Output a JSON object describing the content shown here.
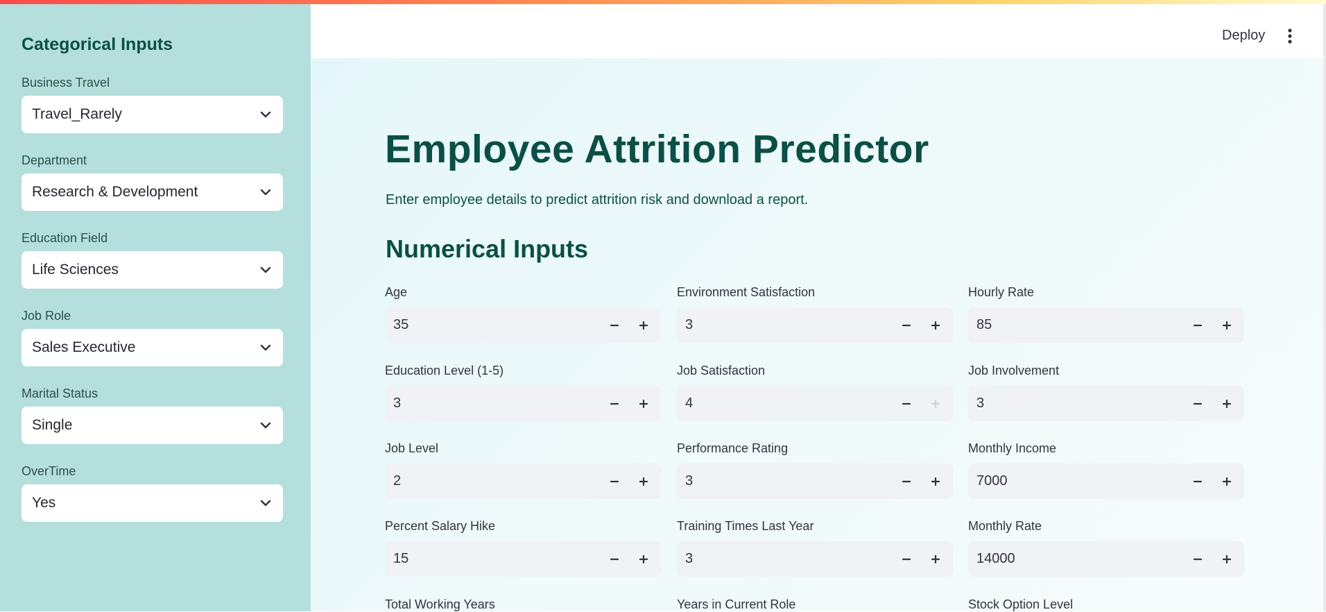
{
  "sidebar": {
    "title": "Categorical Inputs",
    "fields": [
      {
        "label": "Business Travel",
        "value": "Travel_Rarely"
      },
      {
        "label": "Department",
        "value": "Research & Development"
      },
      {
        "label": "Education Field",
        "value": "Life Sciences"
      },
      {
        "label": "Job Role",
        "value": "Sales Executive"
      },
      {
        "label": "Marital Status",
        "value": "Single"
      },
      {
        "label": "OverTime",
        "value": "Yes"
      }
    ]
  },
  "header": {
    "deploy_label": "Deploy",
    "menu_icon": "kebab-menu-icon"
  },
  "main": {
    "title": "Employee Attrition Predictor",
    "subtitle": "Enter employee details to predict attrition risk and download a report.",
    "section_title": "Numerical Inputs",
    "fields": [
      {
        "label": "Age",
        "value": "35"
      },
      {
        "label": "Environment Satisfaction",
        "value": "3"
      },
      {
        "label": "Hourly Rate",
        "value": "85"
      },
      {
        "label": "Education Level (1-5)",
        "value": "3"
      },
      {
        "label": "Job Satisfaction",
        "value": "4"
      },
      {
        "label": "Job Involvement",
        "value": "3"
      },
      {
        "label": "Job Level",
        "value": "2"
      },
      {
        "label": "Performance Rating",
        "value": "3"
      },
      {
        "label": "Monthly Income",
        "value": "7000"
      },
      {
        "label": "Percent Salary Hike",
        "value": "15"
      },
      {
        "label": "Training Times Last Year",
        "value": "3"
      },
      {
        "label": "Monthly Rate",
        "value": "14000"
      },
      {
        "label": "Total Working Years",
        "value": ""
      },
      {
        "label": "Years in Current Role",
        "value": ""
      },
      {
        "label": "Stock Option Level",
        "value": ""
      }
    ]
  },
  "colors": {
    "sidebar_bg": "#b4dfdc",
    "heading": "#0b4f46",
    "input_bg": "#f0f2f6"
  }
}
